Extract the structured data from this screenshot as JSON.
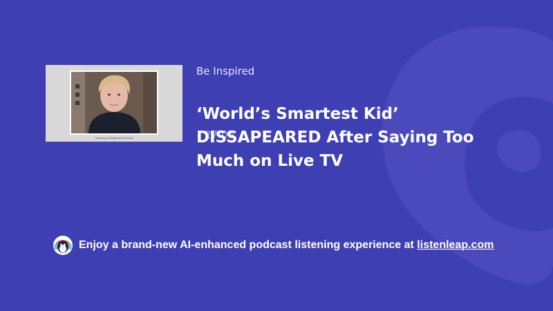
{
  "colors": {
    "background": "#3f3fb4",
    "accent_logo": "#5656c2"
  },
  "thumbnail": {
    "caption": "Courtesy of Nathaniel Genesee"
  },
  "episode": {
    "category": "Be Inspired",
    "title": "‘World’s Smartest Kid’ DISSAPEARED After Saying Too Much on Live TV",
    "timestamp": "27:05"
  },
  "footer": {
    "mascot_icon": "penguin-headphones-icon",
    "promo_text": "Enjoy a brand-new AI-enhanced podcast listening experience at ",
    "link_text": "listenleap.com"
  }
}
